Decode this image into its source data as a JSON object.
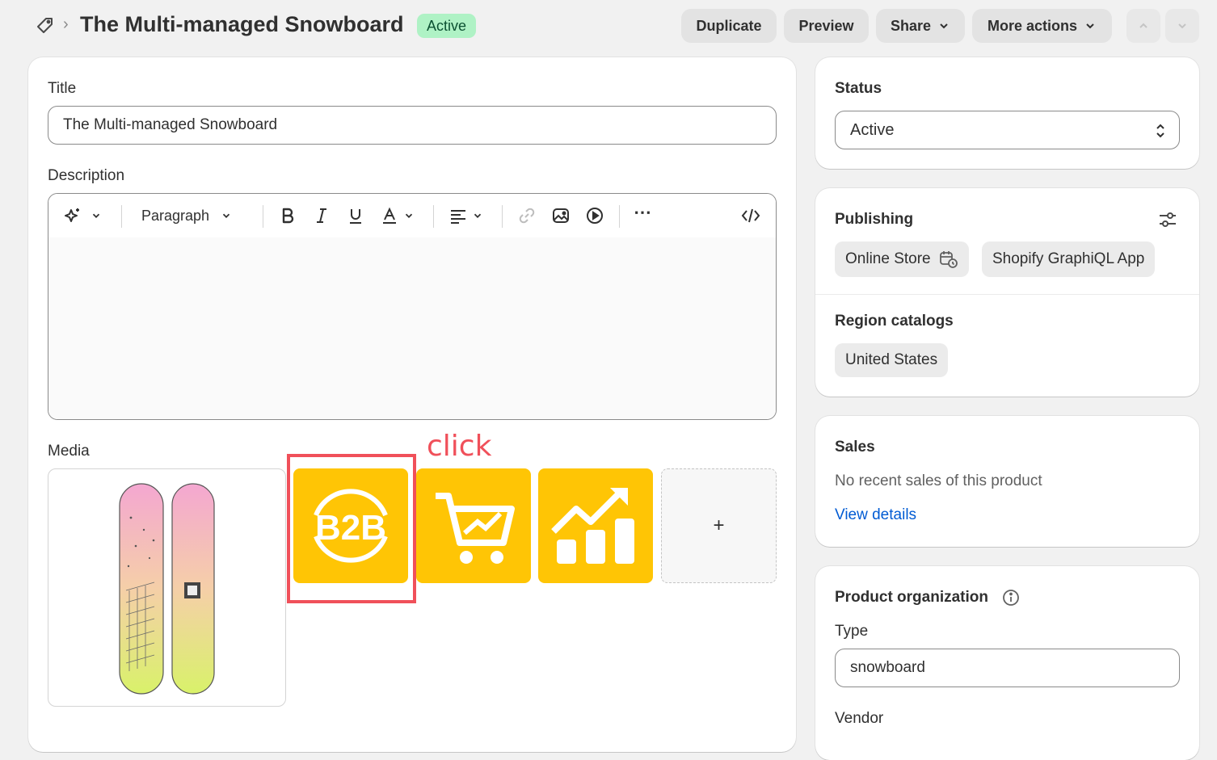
{
  "header": {
    "breadcrumb_sep": "›",
    "title": "The Multi-managed Snowboard",
    "status_badge": "Active",
    "buttons": {
      "duplicate": "Duplicate",
      "preview": "Preview",
      "share": "Share",
      "more_actions": "More actions"
    }
  },
  "main": {
    "title_label": "Title",
    "title_value": "The Multi-managed Snowboard",
    "description_label": "Description",
    "toolbar": {
      "paragraph": "Paragraph",
      "more": "⋯"
    },
    "media_label": "Media",
    "media_add": "+",
    "media_tiles": [
      "product-photo",
      "b2b-logo",
      "cart-growth-logo",
      "growth-chart-logo"
    ],
    "annotation": {
      "text": "click",
      "color": "#f0505a"
    }
  },
  "sidebar": {
    "status": {
      "label": "Status",
      "value": "Active"
    },
    "publishing": {
      "label": "Publishing",
      "channels": [
        "Online Store",
        "Shopify GraphiQL App"
      ],
      "region_label": "Region catalogs",
      "regions": [
        "United States"
      ]
    },
    "sales": {
      "label": "Sales",
      "message": "No recent sales of this product",
      "link": "View details"
    },
    "organization": {
      "label": "Product organization",
      "type_label": "Type",
      "type_value": "snowboard",
      "vendor_label": "Vendor"
    }
  },
  "colors": {
    "accent_yellow": "#ffc505",
    "active_badge_bg": "#aff2c5",
    "link": "#005bd3"
  }
}
